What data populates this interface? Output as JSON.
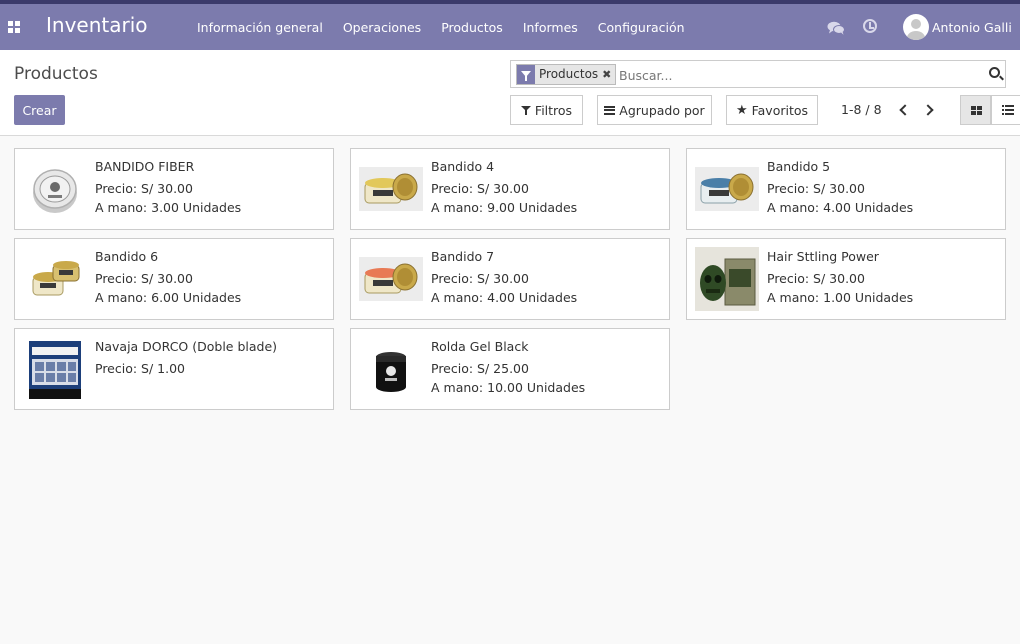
{
  "app": {
    "title": "Inventario"
  },
  "menu": [
    "Información general",
    "Operaciones",
    "Productos",
    "Informes",
    "Configuración"
  ],
  "user": {
    "name": "Antonio Galli"
  },
  "breadcrumb": "Productos",
  "actions": {
    "create_label": "Crear"
  },
  "search": {
    "facet_label": "Productos",
    "facet_remove": "✖",
    "placeholder": "Buscar..."
  },
  "filters": {
    "filters_label": "Filtros",
    "groupby_label": "Agrupado por",
    "favorites_label": "Favoritos",
    "favorites_icon": "★"
  },
  "pager": {
    "value": "1-8 / 8"
  },
  "products": [
    {
      "name": "BANDIDO FIBER",
      "price": "Precio: S/ 30.00",
      "stock": "A mano: 3.00 Unidades",
      "image": "tin-silver-top"
    },
    {
      "name": "Bandido 4",
      "price": "Precio: S/ 30.00",
      "stock": "A mano: 9.00 Unidades",
      "image": "jar-open-yellow"
    },
    {
      "name": "Bandido 5",
      "price": "Precio: S/ 30.00",
      "stock": "A mano: 4.00 Unidades",
      "image": "jar-open-blue"
    },
    {
      "name": "Bandido 6",
      "price": "Precio: S/ 30.00",
      "stock": "A mano: 6.00 Unidades",
      "image": "jar-closed-gold"
    },
    {
      "name": "Bandido 7",
      "price": "Precio: S/ 30.00",
      "stock": "A mano: 4.00 Unidades",
      "image": "jar-open-orange"
    },
    {
      "name": "Hair Sttling Power",
      "price": "Precio: S/ 30.00",
      "stock": "A mano: 1.00 Unidades",
      "image": "skull-jar-green"
    },
    {
      "name": "Navaja DORCO (Doble blade)",
      "price": "Precio: S/ 1.00",
      "stock": "",
      "image": "blade-pack"
    },
    {
      "name": "Rolda Gel Black",
      "price": "Precio: S/ 25.00",
      "stock": "A mano: 10.00 Unidades",
      "image": "black-jar"
    }
  ]
}
